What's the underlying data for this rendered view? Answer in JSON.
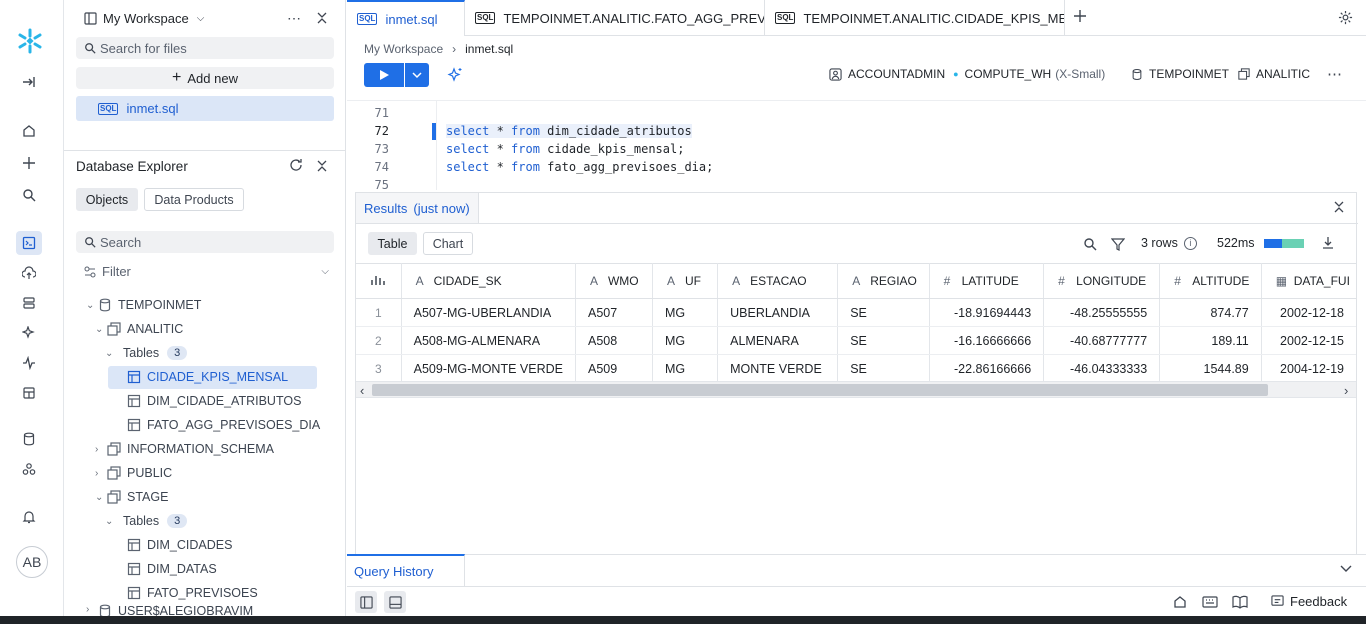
{
  "rail": {
    "avatar": "AB"
  },
  "sidebar": {
    "workspace": "My Workspace",
    "search_placeholder": "Search for files",
    "add_new": "Add new",
    "file": "inmet.sql",
    "db_title": "Database Explorer",
    "tab_objects": "Objects",
    "tab_products": "Data Products",
    "search2_placeholder": "Search",
    "filter": "Filter",
    "tree": {
      "db": "TEMPOINMET",
      "schema1": "ANALITIC",
      "tables1": "Tables",
      "tables1_count": "3",
      "t1": "CIDADE_KPIS_MENSAL",
      "t2": "DIM_CIDADE_ATRIBUTOS",
      "t3": "FATO_AGG_PREVISOES_DIA",
      "schema2": "INFORMATION_SCHEMA",
      "schema3": "PUBLIC",
      "schema4": "STAGE",
      "tables2": "Tables",
      "tables2_count": "3",
      "t4": "DIM_CIDADES",
      "t5": "DIM_DATAS",
      "t6": "FATO_PREVISOES",
      "db2": "USER$ALEGIOBRAVIM"
    }
  },
  "tabs": {
    "t1": "inmet.sql",
    "t2": "TEMPOINMET.ANALITIC.FATO_AGG_PREVISOI",
    "t3": "TEMPOINMET.ANALITIC.CIDADE_KPIS_MENS/"
  },
  "breadcrumb": {
    "root": "My Workspace",
    "file": "inmet.sql"
  },
  "toolbar": {
    "role": "ACCOUNTADMIN",
    "warehouse": "COMPUTE_WH",
    "warehouse_size": "(X-Small)",
    "database": "TEMPOINMET",
    "schema": "ANALITIC"
  },
  "editor": {
    "lines": [
      {
        "n": "71",
        "kw1": "",
        "rest": ""
      },
      {
        "n": "72",
        "kw1": "select",
        "mid": " * ",
        "kw2": "from",
        "rest": " dim_cidade_atributos"
      },
      {
        "n": "73",
        "kw1": "select",
        "mid": " * ",
        "kw2": "from",
        "rest": " cidade_kpis_mensal;"
      },
      {
        "n": "74",
        "kw1": "select",
        "mid": " * ",
        "kw2": "from",
        "rest": " fato_agg_previsoes_dia;"
      },
      {
        "n": "75",
        "kw1": "",
        "rest": ""
      }
    ]
  },
  "results": {
    "tab_label": "Results",
    "tab_time": "(just now)",
    "view_table": "Table",
    "view_chart": "Chart",
    "rows": "3 rows",
    "duration": "522ms",
    "columns": [
      "CIDADE_SK",
      "WMO",
      "UF",
      "ESTACAO",
      "REGIAO",
      "LATITUDE",
      "LONGITUDE",
      "ALTITUDE",
      "DATA_FUI"
    ],
    "data": [
      [
        "1",
        "A507-MG-UBERLANDIA",
        "A507",
        "MG",
        "UBERLANDIA",
        "SE",
        "-18.91694443",
        "-48.25555555",
        "874.77",
        "2002-12-18"
      ],
      [
        "2",
        "A508-MG-ALMENARA",
        "A508",
        "MG",
        "ALMENARA",
        "SE",
        "-16.16666666",
        "-40.68777777",
        "189.11",
        "2002-12-15"
      ],
      [
        "3",
        "A509-MG-MONTE VERDE",
        "A509",
        "MG",
        "MONTE VERDE",
        "SE",
        "-22.86166666",
        "-46.04333333",
        "1544.89",
        "2004-12-19"
      ]
    ]
  },
  "query_history": "Query History",
  "footer": {
    "feedback": "Feedback"
  },
  "colors": {
    "accent": "#1f6fe6",
    "brand": "#29b5e8"
  }
}
